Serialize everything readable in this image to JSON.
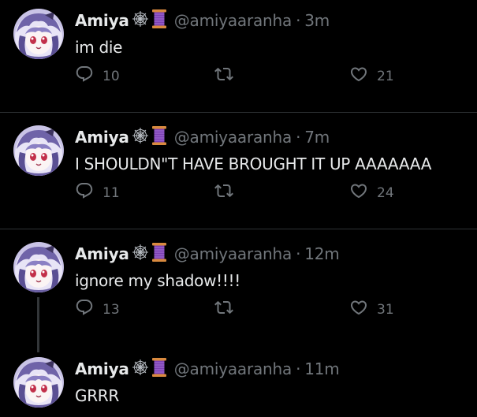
{
  "colors": {
    "background": "#000000",
    "text_primary": "#e7e9ea",
    "text_secondary": "#71767b",
    "divider": "#2f3336",
    "thread_line": "#333639"
  },
  "tweets": [
    {
      "author": "Amiya",
      "handle": "@amiyaaranha",
      "separator": "·",
      "time": "3m",
      "text": "im die",
      "replies": "10",
      "retweets": "",
      "likes": "21",
      "badges": [
        "spider-web-icon",
        "thread-spool-icon"
      ]
    },
    {
      "author": "Amiya",
      "handle": "@amiyaaranha",
      "separator": "·",
      "time": "7m",
      "text": "I SHOULDN\"T HAVE BROUGHT IT UP AAAAAAA",
      "replies": "11",
      "retweets": "",
      "likes": "24",
      "badges": [
        "spider-web-icon",
        "thread-spool-icon"
      ]
    },
    {
      "author": "Amiya",
      "handle": "@amiyaaranha",
      "separator": "·",
      "time": "12m",
      "text": "ignore my shadow!!!!",
      "replies": "13",
      "retweets": "",
      "likes": "31",
      "badges": [
        "spider-web-icon",
        "thread-spool-icon"
      ]
    },
    {
      "author": "Amiya",
      "handle": "@amiyaaranha",
      "separator": "·",
      "time": "11m",
      "text": "GRRR",
      "badges": [
        "spider-web-icon",
        "thread-spool-icon"
      ]
    }
  ]
}
